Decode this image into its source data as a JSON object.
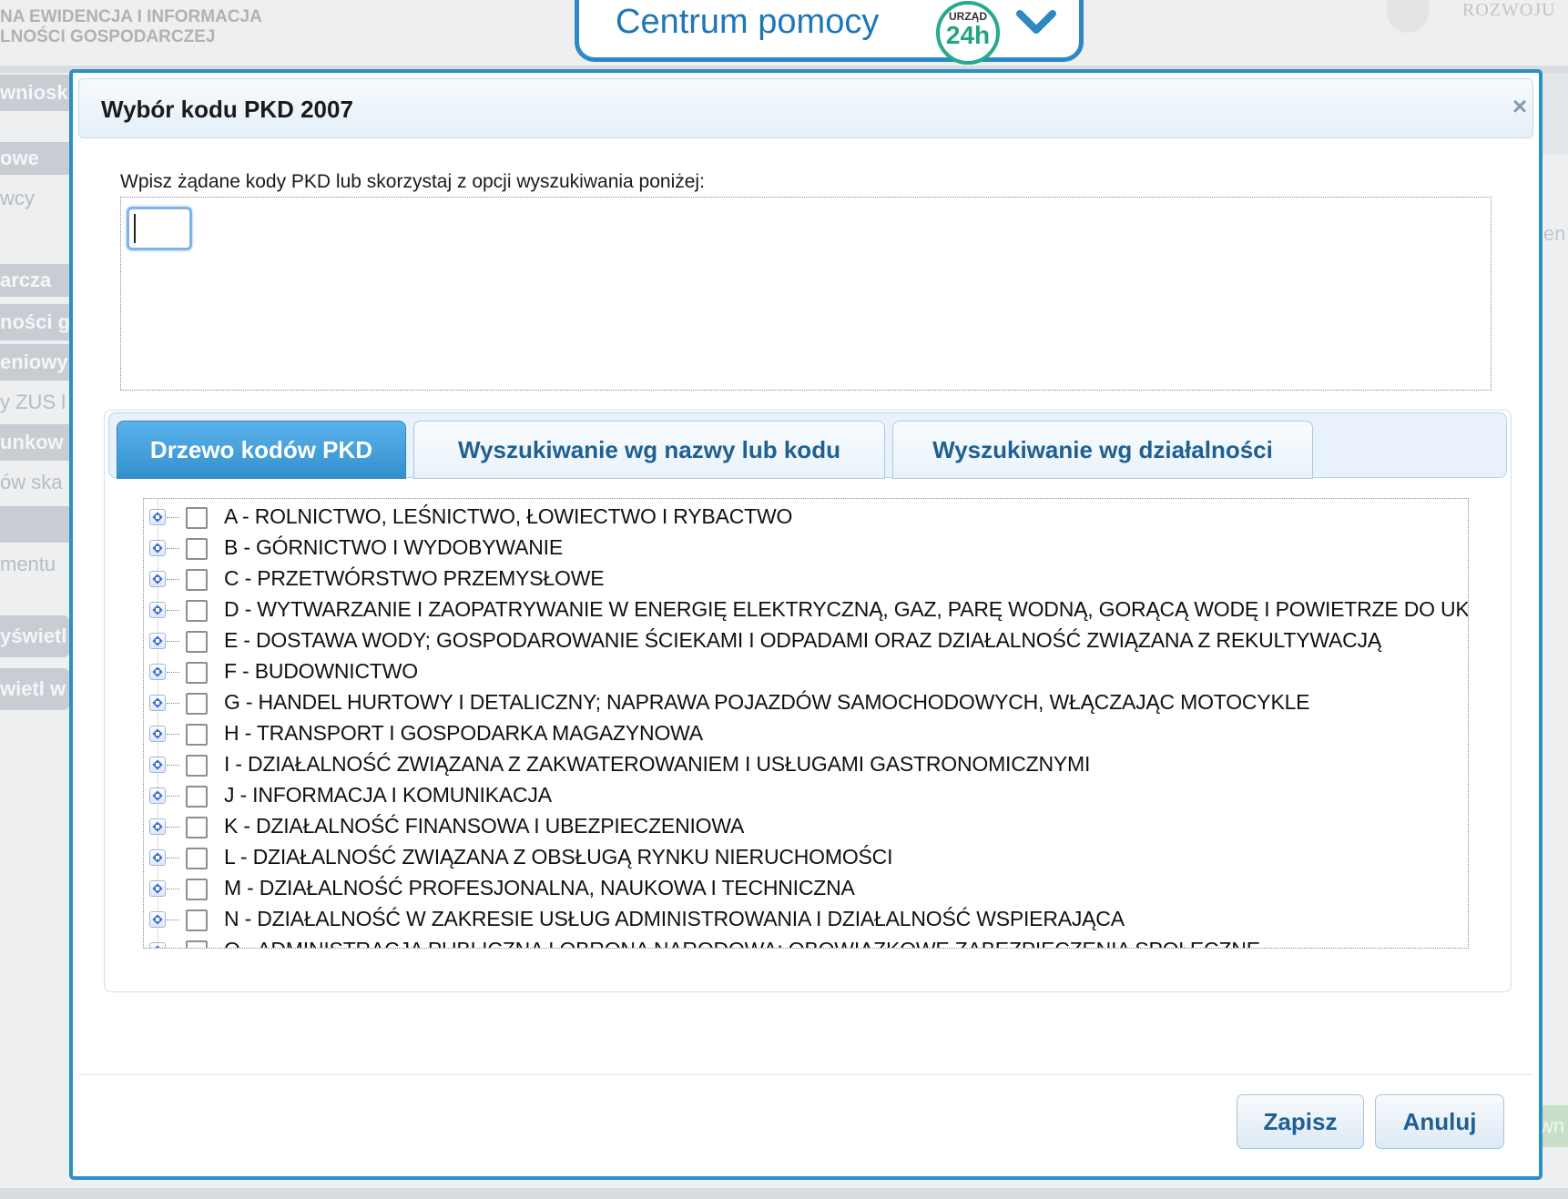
{
  "background": {
    "header_lines": [
      "NA EWIDENCJA I INFORMACJA",
      "LNOŚCI GOSPODARCZEJ"
    ],
    "header_right": "ROZWOJU",
    "sidebar_items": [
      "wniosk",
      "owe",
      "wcy",
      "arcza",
      "ności g",
      "eniowy",
      "y ZUS l",
      "unkow",
      "ów ska",
      "",
      "mentu",
      "yświetl",
      "wietl w"
    ],
    "right_text": "ien",
    "right_button": "wn"
  },
  "help_center": {
    "label": "Centrum pomocy",
    "badge_top": "URZĄD",
    "badge_main": "24h"
  },
  "modal": {
    "title": "Wybór kodu PKD 2007",
    "close_symbol": "×",
    "instruction": "Wpisz żądane kody PKD lub skorzystaj z opcji wyszukiwania poniżej:",
    "input_value": "",
    "tabs": [
      {
        "label": "Drzewo kodów PKD",
        "active": true
      },
      {
        "label": "Wyszukiwanie wg nazwy lub kodu",
        "active": false
      },
      {
        "label": "Wyszukiwanie wg działalności",
        "active": false
      }
    ],
    "tree_items": [
      "A - ROLNICTWO, LEŚNICTWO, ŁOWIECTWO I RYBACTWO",
      "B - GÓRNICTWO I WYDOBYWANIE",
      "C - PRZETWÓRSTWO PRZEMYSŁOWE",
      "D - WYTWARZANIE I ZAOPATRYWANIE W ENERGIĘ ELEKTRYCZNĄ, GAZ, PARĘ WODNĄ, GORĄCĄ WODĘ I POWIETRZE DO UKŁADÓW KLIMATYZACYJNYCH",
      "E - DOSTAWA WODY; GOSPODAROWANIE ŚCIEKAMI I ODPADAMI ORAZ DZIAŁALNOŚĆ ZWIĄZANA Z REKULTYWACJĄ",
      "F - BUDOWNICTWO",
      "G - HANDEL HURTOWY I DETALICZNY; NAPRAWA POJAZDÓW SAMOCHODOWYCH, WŁĄCZAJĄC MOTOCYKLE",
      "H - TRANSPORT I GOSPODARKA MAGAZYNOWA",
      "I - DZIAŁALNOŚĆ ZWIĄZANA Z ZAKWATEROWANIEM I USŁUGAMI GASTRONOMICZNYMI",
      "J - INFORMACJA I KOMUNIKACJA",
      "K - DZIAŁALNOŚĆ FINANSOWA I UBEZPIECZENIOWA",
      "L - DZIAŁALNOŚĆ ZWIĄZANA Z OBSŁUGĄ RYNKU NIERUCHOMOŚCI",
      "M - DZIAŁALNOŚĆ PROFESJONALNA, NAUKOWA I TECHNICZNA",
      "N - DZIAŁALNOŚĆ W ZAKRESIE USŁUG ADMINISTROWANIA I DZIAŁALNOŚĆ WSPIERAJĄCA",
      "O - ADMINISTRACJA PUBLICZNA I OBRONA NARODOWA; OBOWIĄZKOWE ZABEZPIECZENIA SPOŁECZNE"
    ],
    "buttons": {
      "save": "Zapisz",
      "cancel": "Anuluj"
    }
  },
  "colors": {
    "accent": "#2e8ec6",
    "tab_active": "#3490cf",
    "tab_text": "#1f5f92",
    "badge_green": "#22a383"
  }
}
